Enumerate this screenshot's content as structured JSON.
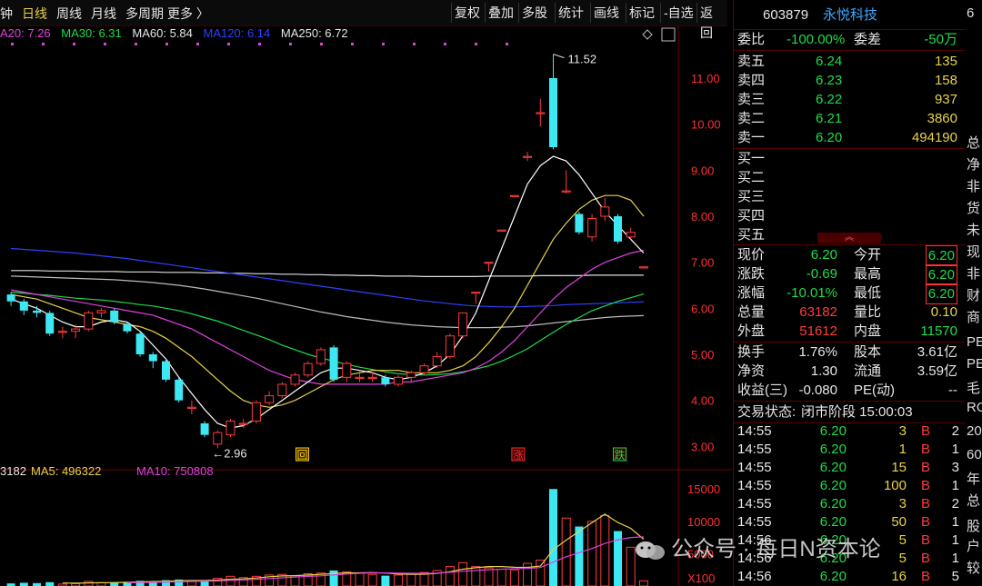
{
  "toolbar": {
    "left_items": [
      "钟",
      "日线",
      "周线",
      "月线",
      "多周期",
      "更多 〉"
    ],
    "buttons": [
      "复权",
      "叠加",
      "多股",
      "统计",
      "画线",
      "标记",
      "-自选",
      "返回"
    ]
  },
  "ma_bar": {
    "ma20": "A20: 7.26",
    "ma30": "MA30: 6.31",
    "ma60": "MA60: 5.84",
    "ma120": "MA120: 6.14",
    "ma250": "MA250: 6.72"
  },
  "colors": {
    "up": "#ff3b3b",
    "down": "#3ee8f2",
    "ma5": "#ffffff",
    "ma10": "#e8d24a",
    "ma20": "#e040e0",
    "ma30": "#1fdc4a",
    "ma60": "#bbbbbb",
    "ma120": "#3040ff",
    "ma250": "#dddddd"
  },
  "chart_data": {
    "type": "candlestick",
    "y_ticks": [
      "11.00",
      "10.00",
      "9.00",
      "8.00",
      "7.00",
      "6.00",
      "5.00",
      "4.00",
      "3.00"
    ],
    "y_range": [
      2.75,
      11.75
    ],
    "annotations": {
      "high": "11.52",
      "low": "←2.96"
    },
    "markers": [
      "回",
      "涨",
      "跌"
    ],
    "candles": [
      {
        "o": 6.3,
        "c": 6.15,
        "h": 6.35,
        "l": 6.05
      },
      {
        "o": 6.15,
        "c": 5.95,
        "h": 6.2,
        "l": 5.85
      },
      {
        "o": 5.95,
        "c": 5.9,
        "h": 6.05,
        "l": 5.8
      },
      {
        "o": 5.9,
        "c": 5.45,
        "h": 5.95,
        "l": 5.4
      },
      {
        "o": 5.5,
        "c": 5.5,
        "h": 5.6,
        "l": 5.35
      },
      {
        "o": 5.5,
        "c": 5.55,
        "h": 5.65,
        "l": 5.35
      },
      {
        "o": 5.55,
        "c": 5.9,
        "h": 5.95,
        "l": 5.5
      },
      {
        "o": 5.9,
        "c": 5.95,
        "h": 6.0,
        "l": 5.8
      },
      {
        "o": 5.95,
        "c": 5.7,
        "h": 6.0,
        "l": 5.65
      },
      {
        "o": 5.65,
        "c": 5.5,
        "h": 5.7,
        "l": 5.45
      },
      {
        "o": 5.45,
        "c": 5.0,
        "h": 5.5,
        "l": 4.95
      },
      {
        "o": 5.0,
        "c": 4.85,
        "h": 5.05,
        "l": 4.7
      },
      {
        "o": 4.85,
        "c": 4.45,
        "h": 4.9,
        "l": 4.4
      },
      {
        "o": 4.45,
        "c": 4.0,
        "h": 4.5,
        "l": 3.95
      },
      {
        "o": 3.85,
        "c": 3.85,
        "h": 4.0,
        "l": 3.7
      },
      {
        "o": 3.5,
        "c": 3.25,
        "h": 3.55,
        "l": 3.2
      },
      {
        "o": 3.05,
        "c": 3.3,
        "h": 3.35,
        "l": 2.96
      },
      {
        "o": 3.25,
        "c": 3.55,
        "h": 3.6,
        "l": 3.2
      },
      {
        "o": 3.5,
        "c": 3.5,
        "h": 3.6,
        "l": 3.4
      },
      {
        "o": 3.55,
        "c": 3.95,
        "h": 4.0,
        "l": 3.5
      },
      {
        "o": 3.95,
        "c": 4.1,
        "h": 4.2,
        "l": 3.9
      },
      {
        "o": 4.1,
        "c": 4.35,
        "h": 4.4,
        "l": 4.05
      },
      {
        "o": 4.35,
        "c": 4.55,
        "h": 4.6,
        "l": 4.3
      },
      {
        "o": 4.55,
        "c": 4.8,
        "h": 4.85,
        "l": 4.5
      },
      {
        "o": 4.8,
        "c": 5.1,
        "h": 5.15,
        "l": 4.75
      },
      {
        "o": 5.15,
        "c": 4.45,
        "h": 5.2,
        "l": 4.4
      },
      {
        "o": 4.5,
        "c": 4.8,
        "h": 4.85,
        "l": 4.4
      },
      {
        "o": 4.5,
        "c": 4.5,
        "h": 4.65,
        "l": 4.4
      },
      {
        "o": 4.5,
        "c": 4.5,
        "h": 4.6,
        "l": 4.4
      },
      {
        "o": 4.5,
        "c": 4.35,
        "h": 4.55,
        "l": 4.3
      },
      {
        "o": 4.35,
        "c": 4.5,
        "h": 4.55,
        "l": 4.3
      },
      {
        "o": 4.5,
        "c": 4.6,
        "h": 4.65,
        "l": 4.4
      },
      {
        "o": 4.6,
        "c": 4.75,
        "h": 4.8,
        "l": 4.55
      },
      {
        "o": 4.75,
        "c": 4.95,
        "h": 5.05,
        "l": 4.7
      },
      {
        "o": 4.95,
        "c": 5.4,
        "h": 5.45,
        "l": 4.9
      },
      {
        "o": 5.4,
        "c": 5.9,
        "h": 5.9,
        "l": 5.35
      },
      {
        "o": 6.35,
        "c": 6.35,
        "h": 6.35,
        "l": 6.1
      },
      {
        "o": 7.0,
        "c": 7.0,
        "h": 7.0,
        "l": 6.8
      },
      {
        "o": 7.7,
        "c": 7.7,
        "h": 7.7,
        "l": 7.7
      },
      {
        "o": 8.45,
        "c": 8.45,
        "h": 8.45,
        "l": 8.45
      },
      {
        "o": 9.3,
        "c": 9.3,
        "h": 9.4,
        "l": 9.2
      },
      {
        "o": 10.25,
        "c": 10.25,
        "h": 10.55,
        "l": 9.95
      },
      {
        "o": 11.0,
        "c": 9.5,
        "h": 11.52,
        "l": 9.45
      },
      {
        "o": 8.55,
        "c": 8.55,
        "h": 9.0,
        "l": 8.5
      },
      {
        "o": 8.05,
        "c": 7.65,
        "h": 8.1,
        "l": 7.6
      },
      {
        "o": 7.55,
        "c": 7.95,
        "h": 8.05,
        "l": 7.45
      },
      {
        "o": 8.0,
        "c": 8.2,
        "h": 8.4,
        "l": 7.9
      },
      {
        "o": 8.0,
        "c": 7.45,
        "h": 8.05,
        "l": 7.4
      },
      {
        "o": 7.55,
        "c": 7.65,
        "h": 7.75,
        "l": 7.5
      },
      {
        "o": 6.9,
        "c": 6.9,
        "h": 6.9,
        "l": 6.9
      }
    ],
    "ma_lines": {
      "ma5": [
        6.2,
        6.1,
        6.0,
        5.85,
        5.7,
        5.6,
        5.6,
        5.7,
        5.75,
        5.7,
        5.5,
        5.2,
        4.9,
        4.5,
        4.15,
        3.8,
        3.5,
        3.4,
        3.45,
        3.6,
        3.8,
        4.0,
        4.2,
        4.4,
        4.6,
        4.7,
        4.7,
        4.65,
        4.6,
        4.5,
        4.45,
        4.5,
        4.6,
        4.75,
        5.0,
        5.4,
        5.9,
        6.6,
        7.3,
        8.0,
        8.7,
        9.1,
        9.3,
        9.2,
        8.9,
        8.5,
        8.1,
        7.8,
        7.5,
        7.2
      ],
      "ma10": [
        6.3,
        6.25,
        6.2,
        6.1,
        6.0,
        5.9,
        5.8,
        5.75,
        5.7,
        5.65,
        5.6,
        5.5,
        5.35,
        5.15,
        4.95,
        4.7,
        4.45,
        4.2,
        4.0,
        3.9,
        3.85,
        3.9,
        4.0,
        4.15,
        4.3,
        4.45,
        4.55,
        4.6,
        4.65,
        4.65,
        4.65,
        4.6,
        4.6,
        4.6,
        4.65,
        4.75,
        4.95,
        5.25,
        5.6,
        6.0,
        6.5,
        7.0,
        7.5,
        7.85,
        8.15,
        8.35,
        8.45,
        8.45,
        8.35,
        8.0
      ],
      "ma20": [
        6.4,
        6.35,
        6.3,
        6.25,
        6.2,
        6.15,
        6.1,
        6.05,
        6.0,
        5.95,
        5.9,
        5.85,
        5.75,
        5.65,
        5.55,
        5.4,
        5.25,
        5.1,
        4.95,
        4.8,
        4.65,
        4.55,
        4.45,
        4.4,
        4.35,
        4.35,
        4.35,
        4.35,
        4.35,
        4.35,
        4.4,
        4.4,
        4.45,
        4.5,
        4.55,
        4.6,
        4.7,
        4.85,
        5.05,
        5.3,
        5.6,
        5.9,
        6.2,
        6.45,
        6.65,
        6.85,
        7.0,
        7.1,
        7.2,
        7.26
      ],
      "ma30": [
        6.35,
        6.33,
        6.3,
        6.28,
        6.25,
        6.22,
        6.2,
        6.18,
        6.15,
        6.12,
        6.08,
        6.05,
        6.0,
        5.95,
        5.88,
        5.8,
        5.72,
        5.62,
        5.52,
        5.42,
        5.32,
        5.2,
        5.1,
        5.0,
        4.92,
        4.85,
        4.78,
        4.72,
        4.67,
        4.62,
        4.58,
        4.56,
        4.55,
        4.56,
        4.58,
        4.62,
        4.68,
        4.75,
        4.85,
        4.98,
        5.12,
        5.3,
        5.48,
        5.65,
        5.8,
        5.95,
        6.05,
        6.15,
        6.23,
        6.31
      ],
      "ma60": [
        6.7,
        6.69,
        6.68,
        6.67,
        6.66,
        6.65,
        6.64,
        6.63,
        6.62,
        6.6,
        6.58,
        6.56,
        6.53,
        6.5,
        6.46,
        6.42,
        6.37,
        6.32,
        6.27,
        6.22,
        6.16,
        6.1,
        6.04,
        5.98,
        5.92,
        5.87,
        5.82,
        5.78,
        5.74,
        5.7,
        5.67,
        5.64,
        5.62,
        5.6,
        5.59,
        5.58,
        5.58,
        5.58,
        5.59,
        5.6,
        5.62,
        5.65,
        5.68,
        5.71,
        5.74,
        5.77,
        5.8,
        5.82,
        5.83,
        5.84
      ],
      "ma120": [
        7.3,
        7.28,
        7.26,
        7.24,
        7.22,
        7.2,
        7.17,
        7.14,
        7.11,
        7.08,
        7.04,
        7.0,
        6.96,
        6.92,
        6.88,
        6.84,
        6.8,
        6.76,
        6.72,
        6.68,
        6.64,
        6.6,
        6.56,
        6.52,
        6.48,
        6.44,
        6.4,
        6.36,
        6.32,
        6.28,
        6.24,
        6.2,
        6.16,
        6.13,
        6.1,
        6.07,
        6.05,
        6.04,
        6.03,
        6.03,
        6.04,
        6.05,
        6.06,
        6.08,
        6.09,
        6.1,
        6.11,
        6.12,
        6.13,
        6.14
      ],
      "ma250": [
        6.82,
        6.82,
        6.82,
        6.81,
        6.81,
        6.81,
        6.8,
        6.8,
        6.8,
        6.79,
        6.79,
        6.79,
        6.78,
        6.78,
        6.78,
        6.77,
        6.77,
        6.76,
        6.76,
        6.75,
        6.75,
        6.74,
        6.74,
        6.73,
        6.73,
        6.72,
        6.72,
        6.71,
        6.71,
        6.7,
        6.7,
        6.7,
        6.69,
        6.69,
        6.69,
        6.69,
        6.69,
        6.7,
        6.7,
        6.7,
        6.7,
        6.71,
        6.71,
        6.71,
        6.71,
        6.72,
        6.72,
        6.72,
        6.72,
        6.72
      ]
    },
    "volume": {
      "header": {
        "vol": "3182",
        "ma5": "MA5: 496322",
        "ma10": "MA10: 750808"
      },
      "y_ticks": [
        "15000",
        "10000",
        "5000",
        "X100"
      ],
      "y_range": [
        0,
        17000
      ],
      "bars": [
        400,
        500,
        450,
        600,
        300,
        350,
        700,
        500,
        600,
        650,
        800,
        700,
        900,
        1000,
        800,
        700,
        1200,
        1500,
        1300,
        1500,
        1700,
        1800,
        1600,
        1900,
        2000,
        2400,
        2200,
        2000,
        1800,
        1600,
        1700,
        1900,
        2100,
        2400,
        3000,
        3600,
        3000,
        2800,
        2600,
        2500,
        3500,
        4000,
        15000,
        10500,
        9200,
        10000,
        10900,
        8500,
        6000,
        800,
        600
      ],
      "ma5": [
        null,
        null,
        null,
        null,
        460,
        440,
        480,
        500,
        520,
        560,
        650,
        690,
        730,
        810,
        840,
        840,
        920,
        1040,
        1100,
        1240,
        1440,
        1560,
        1600,
        1700,
        1800,
        1940,
        2020,
        2040,
        2080,
        2000,
        1860,
        1800,
        1820,
        1940,
        2220,
        2600,
        2820,
        3000,
        3000,
        2900,
        2880,
        3080,
        5640,
        7100,
        8440,
        9800,
        11120,
        9820,
        8920,
        7240,
        5300
      ],
      "ma10": [
        null,
        null,
        null,
        null,
        null,
        null,
        null,
        null,
        null,
        510,
        550,
        565,
        615,
        655,
        700,
        750,
        785,
        870,
        940,
        1030,
        1150,
        1270,
        1370,
        1485,
        1580,
        1720,
        1860,
        1960,
        2040,
        2030,
        2000,
        1960,
        1940,
        2000,
        2120,
        2270,
        2400,
        2520,
        2600,
        2670,
        2720,
        2850,
        3700,
        4520,
        5160,
        5800,
        6580,
        7150,
        7500,
        7600,
        7000
      ]
    }
  },
  "panel": {
    "code": "603879",
    "name": "永悦科技",
    "weibi_label": "委比",
    "weibi_value": "-100.00%",
    "weicha_label": "委差",
    "weicha_value": "-50万",
    "asks": [
      {
        "label": "卖五",
        "price": "6.24",
        "vol": "135"
      },
      {
        "label": "卖四",
        "price": "6.23",
        "vol": "158"
      },
      {
        "label": "卖三",
        "price": "6.22",
        "vol": "937"
      },
      {
        "label": "卖二",
        "price": "6.21",
        "vol": "3860"
      },
      {
        "label": "卖一",
        "price": "6.20",
        "vol": "494190"
      }
    ],
    "bids": [
      {
        "label": "买一"
      },
      {
        "label": "买二"
      },
      {
        "label": "买三"
      },
      {
        "label": "买四"
      },
      {
        "label": "买五"
      }
    ],
    "collapse_symbol": "︽",
    "quote": [
      {
        "l1": "现价",
        "v1": "6.20",
        "l2": "今开",
        "v2": "6.20"
      },
      {
        "l1": "涨跌",
        "v1": "-0.69",
        "l2": "最高",
        "v2": "6.20"
      },
      {
        "l1": "涨幅",
        "v1": "-10.01%",
        "l2": "最低",
        "v2": "6.20"
      },
      {
        "l1": "总量",
        "v1": "63182",
        "l2": "量比",
        "v2": "0.10"
      },
      {
        "l1": "外盘",
        "v1": "51612",
        "l2": "内盘",
        "v2": "11570"
      }
    ],
    "fundamentals": [
      {
        "l1": "换手",
        "v1": "1.76%",
        "l2": "股本",
        "v2": "3.61亿"
      },
      {
        "l1": "净资",
        "v1": "1.30",
        "l2": "流通",
        "v2": "3.59亿"
      },
      {
        "l1": "收益(三)",
        "v1": "-0.080",
        "l2": "PE(动)",
        "v2": "--"
      }
    ],
    "trade_status_label": "交易状态:",
    "trade_status_value": "闭市阶段 15:00:03",
    "ticks": [
      {
        "t": "14:55",
        "p": "6.20",
        "v": "3",
        "s": "B",
        "n": "2"
      },
      {
        "t": "14:55",
        "p": "6.20",
        "v": "1",
        "s": "B",
        "n": "1"
      },
      {
        "t": "14:55",
        "p": "6.20",
        "v": "15",
        "s": "B",
        "n": "3"
      },
      {
        "t": "14:55",
        "p": "6.20",
        "v": "100",
        "s": "B",
        "n": "1"
      },
      {
        "t": "14:55",
        "p": "6.20",
        "v": "3",
        "s": "B",
        "n": "2"
      },
      {
        "t": "14:55",
        "p": "6.20",
        "v": "50",
        "s": "B",
        "n": "1"
      },
      {
        "t": "14:56",
        "p": "6.20",
        "v": "5",
        "s": "B",
        "n": "1"
      },
      {
        "t": "14:56",
        "p": "6.20",
        "v": "5",
        "s": "B",
        "n": "1"
      },
      {
        "t": "14:56",
        "p": "6.20",
        "v": "16",
        "s": "B",
        "n": "5"
      }
    ]
  },
  "far_right": [
    "6",
    "总",
    "净",
    "非",
    "货",
    "未",
    "现",
    "非",
    "财",
    "商",
    "PE",
    "PE",
    "毛",
    "RO",
    "20",
    "60",
    "年",
    "总",
    "股",
    "户",
    "较"
  ],
  "watermark": "公众号 · 每日N资本论"
}
